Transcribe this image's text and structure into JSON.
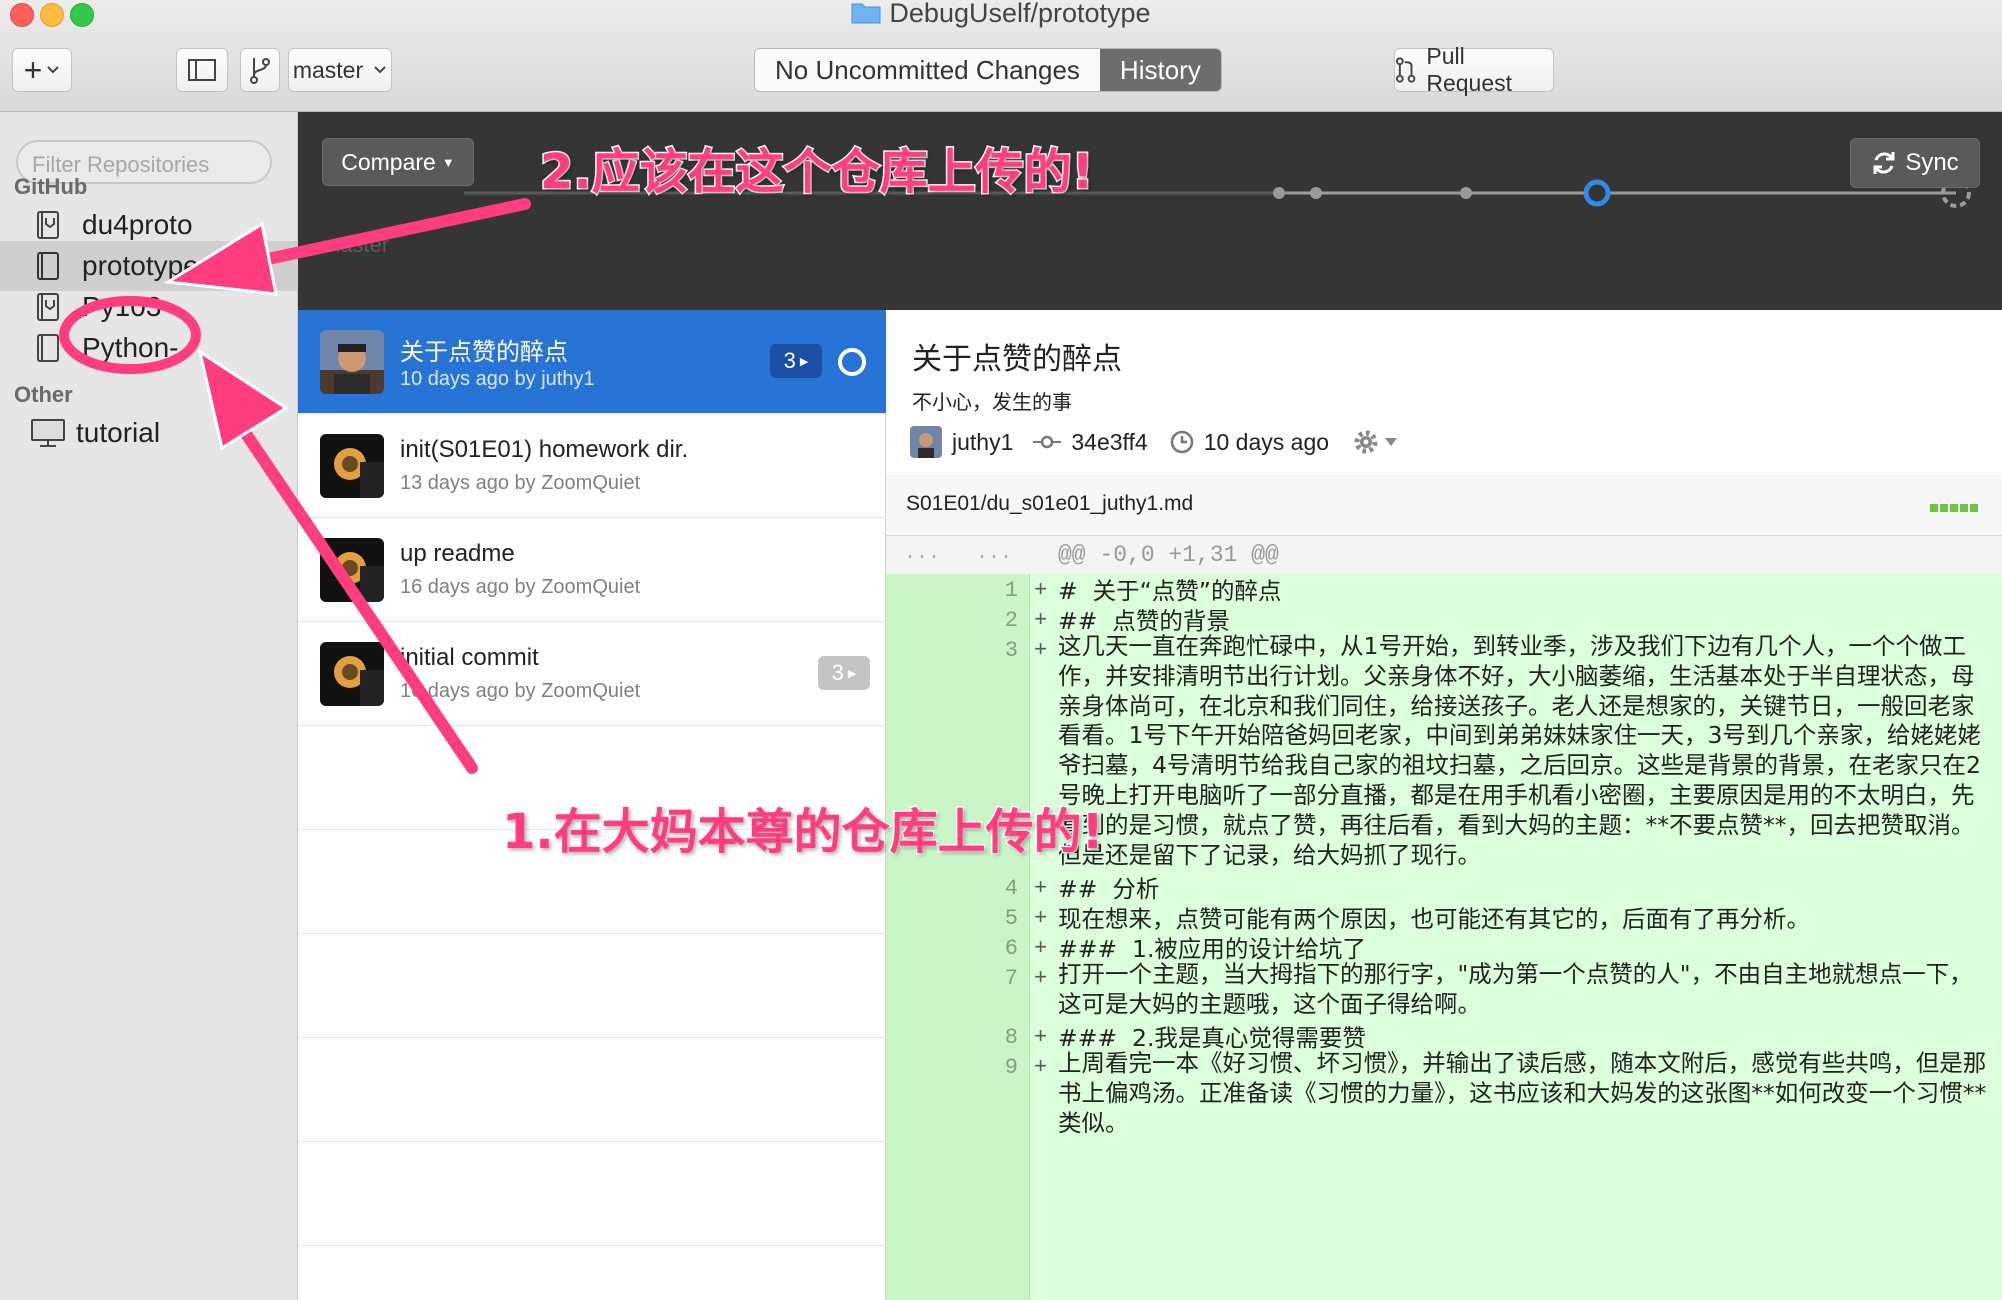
{
  "window": {
    "title": "DebugUself/prototype",
    "colors": {
      "close": "#fc605b",
      "minimize": "#fdbc40",
      "zoom": "#34c84a"
    }
  },
  "toolbar": {
    "add_label": "+",
    "branch": "master",
    "segment": {
      "changes_label": "No Uncommitted Changes",
      "history_label": "History"
    },
    "pull_request_label": "Pull Request"
  },
  "sidebar": {
    "filter_placeholder": "Filter Repositories",
    "sections": [
      {
        "title": "GitHub",
        "repos": [
          "du4proto",
          "prototype",
          "Py103",
          "Python-"
        ]
      },
      {
        "title": "Other",
        "repos": [
          "tutorial"
        ]
      }
    ],
    "selected_repo": "prototype"
  },
  "header": {
    "compare_label": "Compare",
    "sync_label": "Sync"
  },
  "commits": [
    {
      "title": "关于点赞的醉点",
      "meta": "10 days ago by juthy1",
      "badge": "3",
      "selected": true
    },
    {
      "title": "init(S01E01) homework dir.",
      "meta": "13 days ago by ZoomQuiet",
      "badge": "",
      "selected": false
    },
    {
      "title": "up readme",
      "meta": "16 days ago by ZoomQuiet",
      "badge": "",
      "selected": false
    },
    {
      "title": "initial commit",
      "meta": "16 days ago by ZoomQuiet",
      "badge": "3",
      "selected": false
    }
  ],
  "detail": {
    "title": "关于点赞的醉点",
    "description": "不小心，发生的事",
    "author": "juthy1",
    "sha": "34e3ff4",
    "time": "10 days ago",
    "file": "S01E01/du_s01e01_juthy1.md",
    "hunk_gutter_old": "...",
    "hunk_gutter_new": "...",
    "hunk": "@@ -0,0 +1,31 @@",
    "lines": [
      {
        "n": "1",
        "text": "#  关于“点赞”的醉点"
      },
      {
        "n": "2",
        "text": "##  点赞的背景"
      },
      {
        "n": "3",
        "text": "这几天一直在奔跑忙碌中，从1号开始，到转业季，涉及我们下边有几个人，一个个做工作，并安排清明节出行计划。父亲身体不好，大小脑萎缩，生活基本处于半自理状态，母亲身体尚可，在北京和我们同住，给接送孩子。老人还是想家的，关键节日，一般回老家看看。1号下午开始陪爸妈回老家，中间到弟弟妹妹家住一天，3号到几个亲家，给姥姥姥爷扫墓，4号清明节给我自己家的祖坟扫墓，之后回京。这些是背景的背景，在老家只在2号晚上打开电脑听了一部分直播，都是在用手机看小密圈，主要原因是用的不太明白，先看到的是习惯，就点了赞，再往后看，看到大妈的主题：**不要点赞**，回去把赞取消。但是还是留下了记录，给大妈抓了现行。"
      },
      {
        "n": "4",
        "text": "##  分析"
      },
      {
        "n": "5",
        "text": "现在想来，点赞可能有两个原因，也可能还有其它的，后面有了再分析。"
      },
      {
        "n": "6",
        "text": "###  1.被应用的设计给坑了"
      },
      {
        "n": "7",
        "text": "打开一个主题，当大拇指下的那行字，\"成为第一个点赞的人\"，不由自主地就想点一下，这可是大妈的主题哦，这个面子得给啊。"
      },
      {
        "n": "8",
        "text": "###  2.我是真心觉得需要赞"
      },
      {
        "n": "9",
        "text": "上周看完一本《好习惯、坏习惯》，并输出了读后感，随本文附后，感觉有些共鸣，但是那书上偏鸡汤。正准备读《习惯的力量》，这书应该和大妈发的这张图**如何改变一个习惯**类似。"
      }
    ]
  },
  "annotations": {
    "top": "2.应该在这个仓库上传的!",
    "bottom": "1.在大妈本尊的仓库上传的!",
    "color": "#ff3d7f"
  }
}
